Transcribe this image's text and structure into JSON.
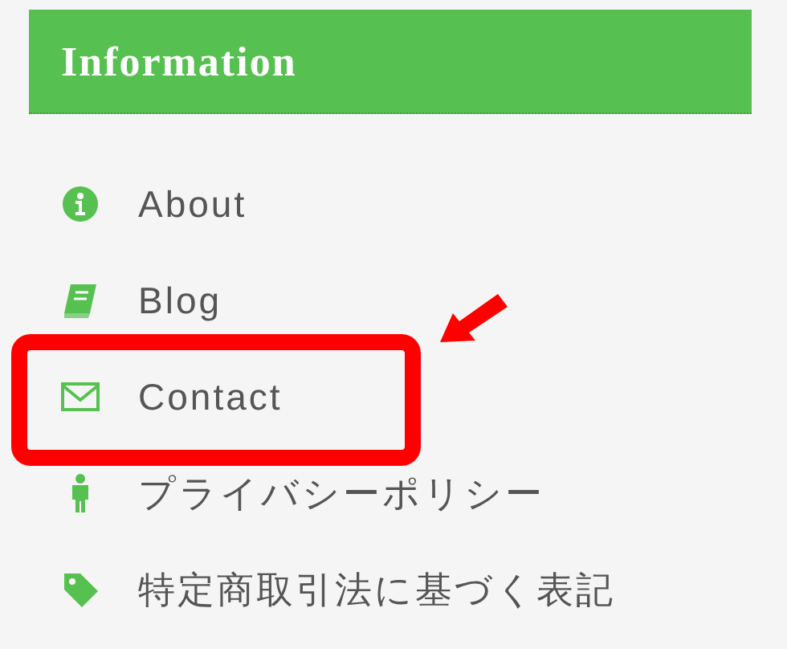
{
  "header": {
    "title": "Information"
  },
  "items": [
    {
      "label": "About",
      "highlighted": false
    },
    {
      "label": "Blog",
      "highlighted": false
    },
    {
      "label": "Contact",
      "highlighted": true
    },
    {
      "label": "プライバシーポリシー",
      "highlighted": false
    },
    {
      "label": "特定商取引法に基づく表記",
      "highlighted": false
    }
  ]
}
